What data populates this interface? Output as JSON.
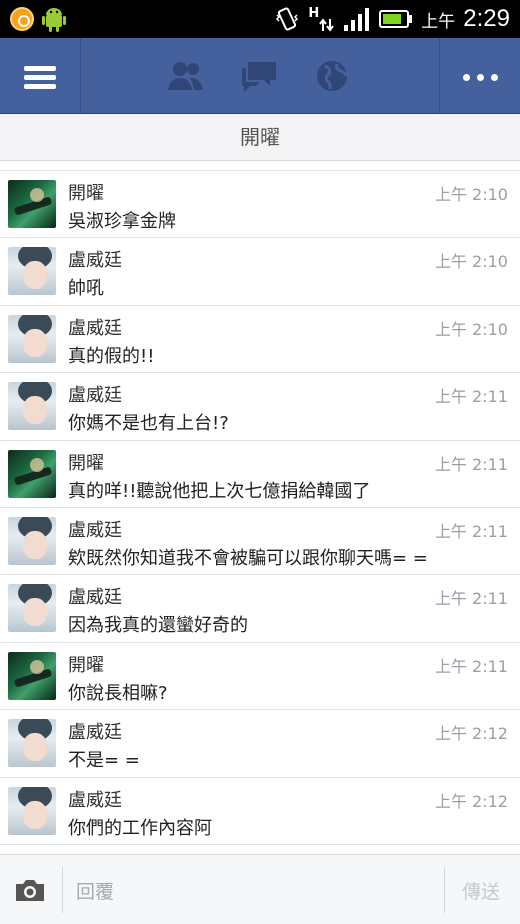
{
  "status_bar": {
    "ampm": "上午",
    "time": "2:29",
    "network_label": "H",
    "icons": [
      "app-notification-icon",
      "android-icon",
      "vibrate-icon",
      "data-transfer-icon",
      "signal-icon",
      "battery-icon"
    ]
  },
  "header": {
    "icons": [
      "menu-icon",
      "friend-requests-icon",
      "messages-icon",
      "notifications-globe-icon",
      "more-icon"
    ],
    "bar_color": "#44619d"
  },
  "thread": {
    "title": "開曜"
  },
  "messages": [
    {
      "name": "開曜",
      "time": "上午 2:10",
      "text": "吳淑珍拿金牌",
      "avatar": "a"
    },
    {
      "name": "盧威廷",
      "time": "上午 2:10",
      "text": "帥吼",
      "avatar": "b"
    },
    {
      "name": "盧威廷",
      "time": "上午 2:10",
      "text": "真的假的!!",
      "avatar": "b"
    },
    {
      "name": "盧威廷",
      "time": "上午 2:11",
      "text": "你媽不是也有上台!?",
      "avatar": "b"
    },
    {
      "name": "開曜",
      "time": "上午 2:11",
      "text": "真的咩!!聽說他把上次七億捐給韓國了",
      "avatar": "a"
    },
    {
      "name": "盧威廷",
      "time": "上午 2:11",
      "text": "欸既然你知道我不會被騙可以跟你聊天嗎= =",
      "avatar": "b"
    },
    {
      "name": "盧威廷",
      "time": "上午 2:11",
      "text": "因為我真的還蠻好奇的",
      "avatar": "b"
    },
    {
      "name": "開曜",
      "time": "上午 2:11",
      "text": "你說長相嘛?",
      "avatar": "a"
    },
    {
      "name": "盧威廷",
      "time": "上午 2:12",
      "text": "不是= =",
      "avatar": "b"
    },
    {
      "name": "盧威廷",
      "time": "上午 2:12",
      "text": "你們的工作內容阿",
      "avatar": "b"
    }
  ],
  "composer": {
    "placeholder": "回覆",
    "send_label": "傳送"
  }
}
